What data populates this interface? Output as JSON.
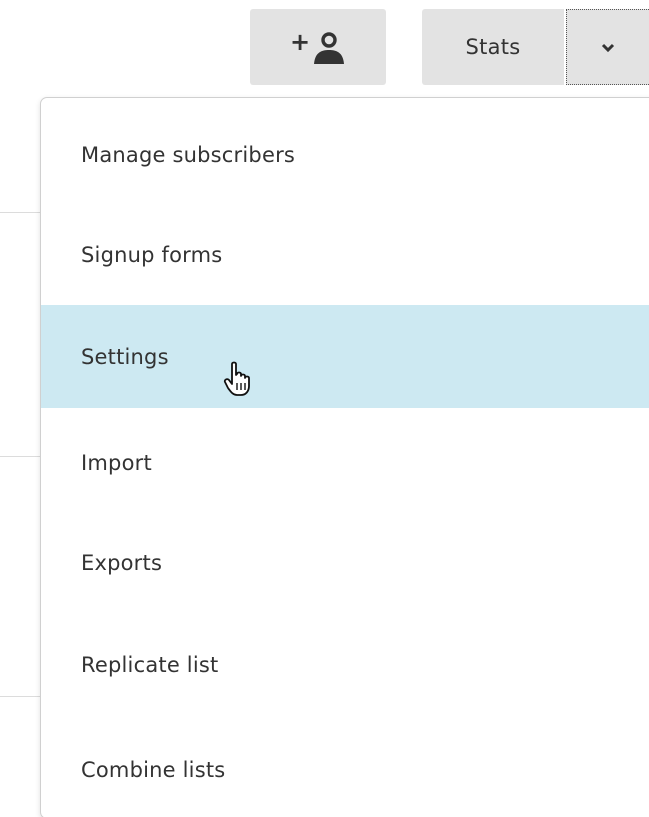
{
  "toolbar": {
    "add_subscriber": {
      "prefix": "+",
      "icon": "person-icon"
    },
    "stats_label": "Stats",
    "caret_icon": "chevron-down-icon"
  },
  "dropdown": {
    "items": [
      {
        "label": "Manage subscribers",
        "highlighted": false
      },
      {
        "label": "Signup forms",
        "highlighted": false
      },
      {
        "label": "Settings",
        "highlighted": true
      },
      {
        "label": "Import",
        "highlighted": false
      },
      {
        "label": "Exports",
        "highlighted": false
      },
      {
        "label": "Replicate list",
        "highlighted": false
      },
      {
        "label": "Combine lists",
        "highlighted": false
      }
    ]
  },
  "colors": {
    "button_bg": "#e3e3e3",
    "highlight_bg": "#cde9f2",
    "text": "#333333"
  },
  "cursor": {
    "type": "hand-pointer-icon"
  }
}
